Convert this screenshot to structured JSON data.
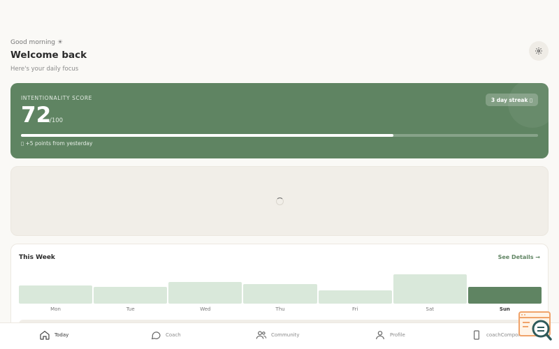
{
  "header": {
    "greeting": "Good morning ☀",
    "title": "Welcome back",
    "subtitle": "Here's your daily focus"
  },
  "score": {
    "label": "INTENTIONALITY SCORE",
    "value": "72",
    "max": "/100",
    "progress_fraction": 0.72,
    "streak": "3 day streak ▯",
    "change": "▯ +5 points from yesterday"
  },
  "week": {
    "title": "This Week",
    "details_link": "See Details →",
    "days": [
      {
        "label": "Mon",
        "level": 0.62,
        "active": false
      },
      {
        "label": "Tue",
        "level": 0.57,
        "active": false
      },
      {
        "label": "Wed",
        "level": 0.74,
        "active": false
      },
      {
        "label": "Thu",
        "level": 0.67,
        "active": false
      },
      {
        "label": "Fri",
        "level": 0.45,
        "active": false
      },
      {
        "label": "Sat",
        "level": 1.0,
        "active": false
      },
      {
        "label": "Sun",
        "level": 0.57,
        "active": true
      }
    ]
  },
  "nav": {
    "items": [
      {
        "label": "Today",
        "icon": "home-icon",
        "active": true
      },
      {
        "label": "Coach",
        "icon": "chat-bubble-icon",
        "active": false
      },
      {
        "label": "Community",
        "icon": "users-icon",
        "active": false
      },
      {
        "label": "Profile",
        "icon": "user-icon",
        "active": false
      },
      {
        "label": "coachComponents",
        "icon": "phone-icon",
        "active": false
      }
    ]
  },
  "colors": {
    "accent": "#5f8462",
    "bar_light": "#d9e8da",
    "background": "#faf9f6"
  }
}
